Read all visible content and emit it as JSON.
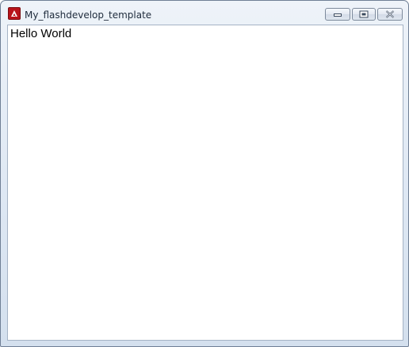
{
  "window": {
    "title": "My_flashdevelop_template",
    "icon": "adobe-air-icon",
    "controls": {
      "minimize": "minimize-icon",
      "maximize": "maximize-icon",
      "close": "close-icon"
    }
  },
  "content": {
    "text": "Hello World"
  },
  "colors": {
    "icon_red": "#b8141a",
    "frame": "#dde7f3",
    "client_bg": "#ffffff"
  }
}
